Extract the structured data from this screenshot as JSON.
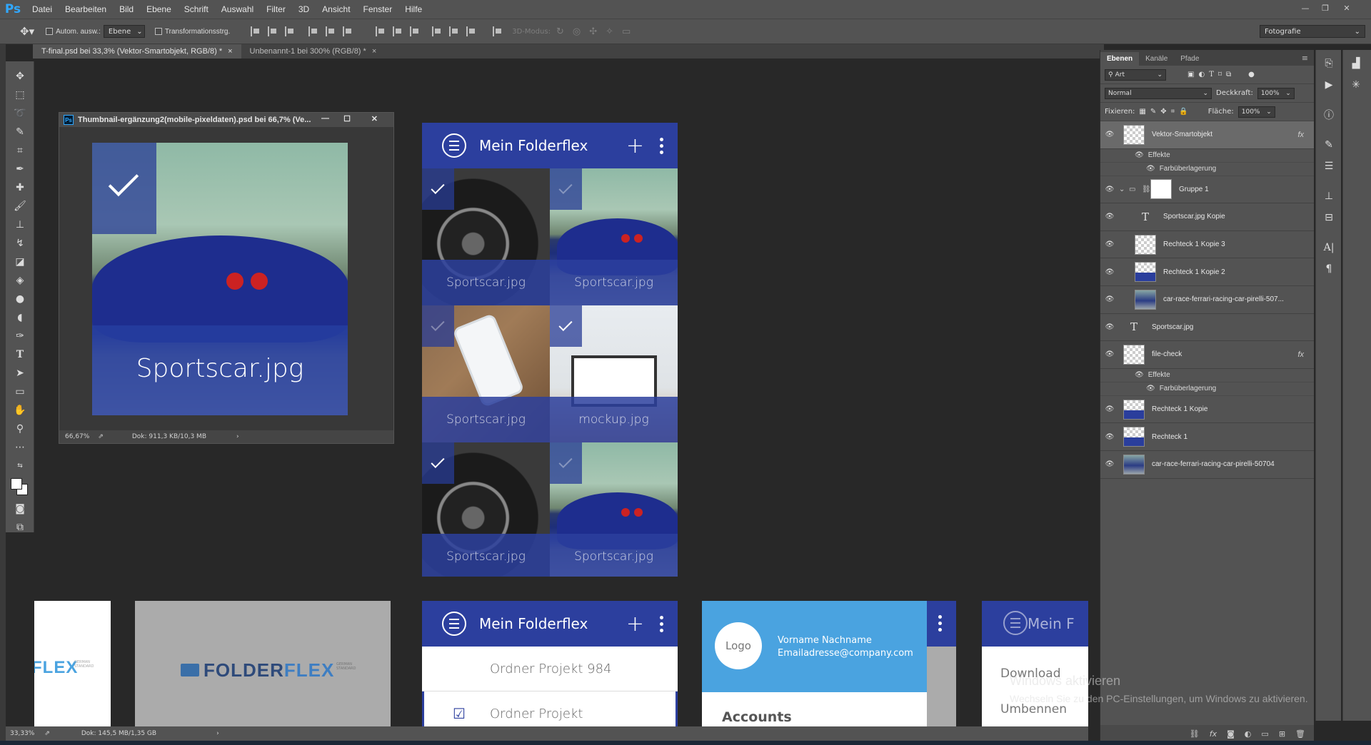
{
  "menubar": {
    "logo": "Ps",
    "items": [
      "Datei",
      "Bearbeiten",
      "Bild",
      "Ebene",
      "Schrift",
      "Auswahl",
      "Filter",
      "3D",
      "Ansicht",
      "Fenster",
      "Hilfe"
    ]
  },
  "options": {
    "auto_select": "Autom. ausw.:",
    "auto_select_target": "Ebene",
    "transform_controls": "Transformationsstrg.",
    "mode_3d": "3D-Modus:",
    "workspace": "Fotografie"
  },
  "doc_tabs": [
    {
      "label": "T-final.psd bei 33,3% (Vektor-Smartobjekt, RGB/8) *",
      "close": "×"
    },
    {
      "label": "Unbenannt-1 bei 300% (RGB/8) *",
      "close": "×"
    }
  ],
  "float_window": {
    "title": "Thumbnail-ergänzung2(mobile-pixeldaten).psd bei 66,7% (Ve...",
    "caption": "Sportscar.jpg",
    "zoom": "66,67%",
    "doc_info": "Dok: 911,3 KB/10,3 MB"
  },
  "app_main": {
    "title": "Mein Folderflex",
    "tiles": [
      {
        "label": "Sportscar.jpg",
        "checked": true
      },
      {
        "label": "Sportscar.jpg",
        "checked": false
      },
      {
        "label": "Sportscar.jpg",
        "checked": false
      },
      {
        "label": "mockup.jpg",
        "checked": true
      },
      {
        "label": "Sportscar.jpg",
        "checked": true
      },
      {
        "label": "Sportscar.jpg",
        "checked": false
      }
    ]
  },
  "artboards": {
    "logo_left": "FLEX",
    "logo_sub": "GERMAN STANDARD",
    "logo_center_a": "FOLDER",
    "logo_center_b": "FLEX",
    "app_list_title": "Mein Folderflex",
    "list_items": [
      "Ordner Projekt 984",
      "Ordner Projekt"
    ],
    "account_logo": "Logo",
    "account_name": "Vorname Nachname",
    "account_email": "Emailadresse@company.com",
    "accounts_label": "Accounts",
    "partial_title": "Mein F",
    "menu_download": "Download",
    "menu_rename": "Umbennen"
  },
  "layers_panel": {
    "tabs": [
      "Ebenen",
      "Kanäle",
      "Pfade"
    ],
    "filter_kind": "Art",
    "blend_mode": "Normal",
    "opacity_label": "Deckkraft:",
    "opacity": "100%",
    "lock_label": "Fixieren:",
    "fill_label": "Fläche:",
    "fill": "100%",
    "layers": [
      {
        "name": "Vektor-Smartobjekt",
        "thumb": "checker",
        "fx": true,
        "selected": true
      },
      {
        "name": "Effekte",
        "sub": true
      },
      {
        "name": "Farbüberlagerung",
        "sub": true
      },
      {
        "name": "Gruppe 1",
        "thumb": "group"
      },
      {
        "name": "Sportscar.jpg Kopie",
        "thumb": "text"
      },
      {
        "name": "Rechteck 1 Kopie 3",
        "thumb": "checker"
      },
      {
        "name": "Rechteck 1 Kopie 2",
        "thumb": "checker-blue"
      },
      {
        "name": "car-race-ferrari-racing-car-pirelli-507...",
        "thumb": "photo"
      },
      {
        "name": "Sportscar.jpg",
        "thumb": "text"
      },
      {
        "name": "file-check",
        "thumb": "checker",
        "fx": true
      },
      {
        "name": "Effekte",
        "sub": true
      },
      {
        "name": "Farbüberlagerung",
        "sub": true
      },
      {
        "name": "Rechteck 1 Kopie",
        "thumb": "checker-blue"
      },
      {
        "name": "Rechteck 1",
        "thumb": "checker-blue"
      },
      {
        "name": "car-race-ferrari-racing-car-pirelli-50704",
        "thumb": "photo"
      }
    ],
    "fx_label": "fx"
  },
  "status": {
    "zoom": "33,33%",
    "doc_info": "Dok: 145,5 MB/1,35 GB"
  },
  "watermark": {
    "line1": "Windows aktivieren",
    "line2": "Wechseln Sie zu den PC-Einstellungen, um Windows zu aktivieren."
  },
  "colors": {
    "app_blue": "#2c3f9e",
    "account_blue": "#4aa3e0",
    "ps_chrome": "#535353",
    "canvas_bg": "#282828"
  }
}
